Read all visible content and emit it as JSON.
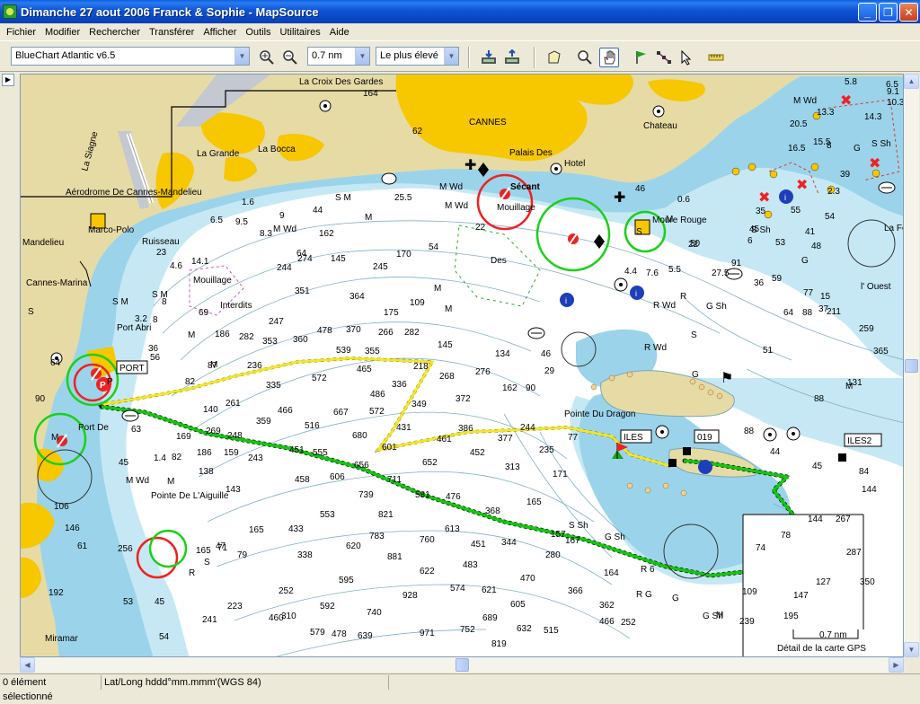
{
  "window": {
    "title": "Dimanche 27 aout 2006 Franck & Sophie - MapSource",
    "minimize": "_",
    "restore": "❐",
    "close": "✕"
  },
  "menu": [
    "Fichier",
    "Modifier",
    "Rechercher",
    "Transférer",
    "Afficher",
    "Outils",
    "Utilitaires",
    "Aide"
  ],
  "toolbar": {
    "map_product": "BlueChart Atlantic v6.5",
    "zoom_scale": "0.7 nm",
    "detail_level": "Le plus élevé"
  },
  "map": {
    "places": {
      "la_croix_des_gardes": "La Croix Des Gardes",
      "cannes": "CANNES",
      "la_bocca": "La Bocca",
      "la_grande": "La Grande",
      "aerodrome": "Aérodrome De Cannes-Mandelieu",
      "la_siagne": "La Siagne",
      "mandelieu": "Mandelieu",
      "marco_polo": "Marco-Polo",
      "ruisseau": "Ruisseau",
      "cannes_marina": "Cannes-Marina",
      "port_abri": "Port Abri",
      "port": "PORT",
      "port_de": "Port De",
      "pointe_aiguille": "Pointe De L'Aiguille",
      "miramar": "Miramar",
      "palais_des": "Palais Des",
      "hotel": "Hotel",
      "secant": "Sécant",
      "mouillage1": "Mouillage",
      "mouillage2": "Mouillage",
      "interdits": "Interdits",
      "des": "Des",
      "chateau": "Chateau",
      "moure_rouge": "Moure Rouge",
      "pointe_du_dragon": "Pointe Du Dragon",
      "iles": "ILES",
      "iles2": "ILES2",
      "wp_019": "019",
      "la_fou": "La Fou",
      "l_ouest": "l' Ouest"
    },
    "scale_label": "0.7 nm",
    "detail_caption": "Détail de la carte GPS",
    "soundings": [
      [
        "164",
        403,
        106
      ],
      [
        "62",
        458,
        148
      ],
      [
        "25.5",
        438,
        222
      ],
      [
        "44",
        347,
        236
      ],
      [
        "M Wd",
        488,
        210
      ],
      [
        "S M",
        372,
        222
      ],
      [
        "M",
        405,
        244
      ],
      [
        "M Wd",
        494,
        231
      ],
      [
        "22",
        528,
        255
      ],
      [
        "9",
        310,
        242
      ],
      [
        "8.3",
        288,
        262
      ],
      [
        "9.5",
        261,
        249
      ],
      [
        "1.6",
        268,
        227
      ],
      [
        "6.5",
        233,
        247
      ],
      [
        "4.6",
        188,
        298
      ],
      [
        "14.1",
        212,
        293
      ],
      [
        "69",
        220,
        350
      ],
      [
        "8",
        179,
        338
      ],
      [
        "M Wd",
        303,
        257
      ],
      [
        "162",
        354,
        262
      ],
      [
        "64",
        329,
        284
      ],
      [
        "274",
        330,
        290
      ],
      [
        "145",
        367,
        290
      ],
      [
        "245",
        414,
        299
      ],
      [
        "170",
        440,
        285
      ],
      [
        "54",
        476,
        277
      ],
      [
        "244",
        307,
        300
      ],
      [
        "351",
        327,
        326
      ],
      [
        "364",
        388,
        332
      ],
      [
        "175",
        426,
        350
      ],
      [
        "109",
        455,
        339
      ],
      [
        "M",
        482,
        323
      ],
      [
        "M",
        494,
        346
      ],
      [
        "247",
        298,
        360
      ],
      [
        "353",
        291,
        382
      ],
      [
        "360",
        325,
        380
      ],
      [
        "478",
        352,
        370
      ],
      [
        "370",
        384,
        369
      ],
      [
        "266",
        420,
        372
      ],
      [
        "282",
        449,
        372
      ],
      [
        "186",
        238,
        374
      ],
      [
        "282",
        265,
        377
      ],
      [
        "236",
        274,
        409
      ],
      [
        "M",
        208,
        375
      ],
      [
        "M",
        233,
        408
      ],
      [
        "82",
        205,
        427
      ],
      [
        "87",
        230,
        409
      ],
      [
        "336",
        435,
        430
      ],
      [
        "486",
        411,
        441
      ],
      [
        "572",
        410,
        460
      ],
      [
        "349",
        457,
        452
      ],
      [
        "372",
        506,
        446
      ],
      [
        "134",
        550,
        396
      ],
      [
        "162",
        558,
        434
      ],
      [
        "90",
        584,
        434
      ],
      [
        "46",
        601,
        396
      ],
      [
        "29",
        605,
        415
      ],
      [
        "335",
        295,
        431
      ],
      [
        "572",
        346,
        423
      ],
      [
        "465",
        396,
        413
      ],
      [
        "355",
        405,
        393
      ],
      [
        "539",
        373,
        392
      ],
      [
        "218",
        459,
        410
      ],
      [
        "268",
        488,
        421
      ],
      [
        "145",
        486,
        386
      ],
      [
        "276",
        528,
        416
      ],
      [
        "261",
        250,
        451
      ],
      [
        "140",
        225,
        458
      ],
      [
        "359",
        284,
        471
      ],
      [
        "466",
        308,
        459
      ],
      [
        "516",
        338,
        476
      ],
      [
        "667",
        370,
        461
      ],
      [
        "680",
        391,
        487
      ],
      [
        "431",
        440,
        478
      ],
      [
        "461",
        485,
        491
      ],
      [
        "386",
        509,
        479
      ],
      [
        "377",
        553,
        490
      ],
      [
        "244",
        578,
        478
      ],
      [
        "77",
        631,
        489
      ],
      [
        "601",
        424,
        500
      ],
      [
        "652",
        469,
        517
      ],
      [
        "452",
        522,
        506
      ],
      [
        "313",
        561,
        522
      ],
      [
        "235",
        599,
        503
      ],
      [
        "171",
        614,
        530
      ],
      [
        "269",
        228,
        482
      ],
      [
        "248",
        252,
        487
      ],
      [
        "169",
        195,
        488
      ],
      [
        "451",
        321,
        503
      ],
      [
        "555",
        347,
        506
      ],
      [
        "656",
        393,
        520
      ],
      [
        "711",
        430,
        536
      ],
      [
        "186",
        218,
        506
      ],
      [
        "138",
        220,
        527
      ],
      [
        "159",
        248,
        506
      ],
      [
        "243",
        275,
        512
      ],
      [
        "458",
        327,
        536
      ],
      [
        "606",
        366,
        533
      ],
      [
        "739",
        398,
        553
      ],
      [
        "821",
        420,
        575
      ],
      [
        "581",
        461,
        553
      ],
      [
        "476",
        495,
        555
      ],
      [
        "368",
        539,
        571
      ],
      [
        "165",
        585,
        561
      ],
      [
        "S Sh",
        632,
        587
      ],
      [
        "157",
        612,
        597
      ],
      [
        "143",
        250,
        547
      ],
      [
        "165",
        276,
        592
      ],
      [
        "553",
        355,
        575
      ],
      [
        "433",
        320,
        591
      ],
      [
        "620",
        384,
        610
      ],
      [
        "783",
        410,
        599
      ],
      [
        "760",
        466,
        603
      ],
      [
        "613",
        494,
        591
      ],
      [
        "451",
        523,
        608
      ],
      [
        "344",
        557,
        606
      ],
      [
        "280",
        606,
        620
      ],
      [
        "167",
        628,
        604
      ],
      [
        "G Sh",
        672,
        600
      ],
      [
        "71",
        241,
        612
      ],
      [
        "47",
        239,
        610
      ],
      [
        "79",
        263,
        620
      ],
      [
        "338",
        330,
        620
      ],
      [
        "881",
        430,
        622
      ],
      [
        "622",
        466,
        638
      ],
      [
        "483",
        514,
        631
      ],
      [
        "470",
        578,
        646
      ],
      [
        "164",
        671,
        640
      ],
      [
        "595",
        376,
        648
      ],
      [
        "928",
        447,
        665
      ],
      [
        "574",
        500,
        657
      ],
      [
        "621",
        535,
        659
      ],
      [
        "366",
        631,
        660
      ],
      [
        "362",
        666,
        676
      ],
      [
        "R 6",
        712,
        636
      ],
      [
        "R G",
        707,
        664
      ],
      [
        "G",
        747,
        668
      ],
      [
        "109",
        825,
        661
      ],
      [
        "M",
        796,
        687
      ],
      [
        "G Sh",
        781,
        688
      ],
      [
        "239",
        822,
        694
      ],
      [
        "147",
        882,
        665
      ],
      [
        "127",
        907,
        650
      ],
      [
        "195",
        871,
        688
      ],
      [
        "350",
        956,
        650
      ],
      [
        "287",
        941,
        617
      ],
      [
        "144",
        958,
        547
      ],
      [
        "267",
        929,
        580
      ],
      [
        "144",
        898,
        580
      ],
      [
        "78",
        868,
        598
      ],
      [
        "74",
        840,
        612
      ],
      [
        "45",
        903,
        521
      ],
      [
        "84",
        955,
        527
      ],
      [
        "88",
        827,
        482
      ],
      [
        "44",
        856,
        505
      ],
      [
        "252",
        690,
        695
      ],
      [
        "466",
        666,
        694
      ],
      [
        "605",
        567,
        675
      ],
      [
        "632",
        574,
        702
      ],
      [
        "515",
        604,
        704
      ],
      [
        "819",
        546,
        719
      ],
      [
        "752",
        511,
        703
      ],
      [
        "689",
        536,
        690
      ],
      [
        "971",
        466,
        707
      ],
      [
        "740",
        407,
        684
      ],
      [
        "592",
        355,
        677
      ],
      [
        "478",
        368,
        708
      ],
      [
        "639",
        397,
        710
      ],
      [
        "579",
        344,
        706
      ],
      [
        "460",
        298,
        690
      ],
      [
        "310",
        312,
        688
      ],
      [
        "252",
        309,
        660
      ],
      [
        "241",
        224,
        692
      ],
      [
        "223",
        252,
        677
      ],
      [
        "192",
        53,
        662
      ],
      [
        "256",
        130,
        613
      ],
      [
        "146",
        71,
        590
      ],
      [
        "106",
        59,
        566
      ],
      [
        "45",
        131,
        517
      ],
      [
        "82",
        190,
        511
      ],
      [
        "63",
        145,
        480
      ],
      [
        "61",
        85,
        610
      ],
      [
        "53",
        136,
        672
      ],
      [
        "45",
        171,
        672
      ],
      [
        "54",
        176,
        711
      ],
      [
        "165",
        217,
        615
      ],
      [
        "R",
        209,
        640
      ],
      [
        "S",
        226,
        628
      ],
      [
        "1.4",
        170,
        512
      ],
      [
        "36",
        164,
        390
      ],
      [
        "56",
        166,
        400
      ],
      [
        "S M",
        168,
        330
      ],
      [
        "M",
        56,
        489
      ],
      [
        "M",
        185,
        538
      ],
      [
        "M Wd",
        139,
        537
      ],
      [
        "90",
        38,
        446
      ],
      [
        "64",
        55,
        406
      ],
      [
        "S",
        30,
        349
      ],
      [
        "S M",
        124,
        338
      ],
      [
        "23",
        173,
        283
      ],
      [
        "3.2",
        149,
        357
      ],
      [
        "P",
        118,
        427
      ],
      [
        "8",
        169,
        358
      ]
    ],
    "soundings_right": [
      [
        "M Wd",
        882,
        114
      ],
      [
        "13.3",
        908,
        127
      ],
      [
        "20.5",
        878,
        140
      ],
      [
        "16.5",
        876,
        167
      ],
      [
        "15.5",
        904,
        160
      ],
      [
        "8",
        919,
        164
      ],
      [
        "39",
        934,
        196
      ],
      [
        "2.3",
        920,
        215
      ],
      [
        "55",
        879,
        236
      ],
      [
        "35",
        840,
        237
      ],
      [
        "54",
        917,
        243
      ],
      [
        "45",
        833,
        257
      ],
      [
        "6",
        831,
        270
      ],
      [
        "S Sh",
        835,
        258
      ],
      [
        "53",
        862,
        272
      ],
      [
        "41",
        895,
        260
      ],
      [
        "48",
        902,
        276
      ],
      [
        "G",
        891,
        292
      ],
      [
        "91",
        813,
        295
      ],
      [
        "36",
        838,
        317
      ],
      [
        "59",
        858,
        312
      ],
      [
        "77",
        893,
        328
      ],
      [
        "15",
        912,
        332
      ],
      [
        "37",
        910,
        346
      ],
      [
        "64",
        871,
        350
      ],
      [
        "88",
        892,
        350
      ],
      [
        "211",
        919,
        349
      ],
      [
        "259",
        955,
        368
      ],
      [
        "131",
        942,
        428
      ],
      [
        "88",
        905,
        446
      ],
      [
        "365",
        971,
        393
      ],
      [
        "6.5",
        985,
        96
      ],
      [
        "9.1",
        986,
        104
      ],
      [
        "10.3",
        986,
        116
      ],
      [
        "5.8",
        939,
        93
      ],
      [
        "14.3",
        961,
        132
      ],
      [
        "S Sh",
        969,
        162
      ],
      [
        "G",
        949,
        167
      ],
      [
        "M",
        940,
        432
      ],
      [
        "G Sh",
        785,
        343
      ],
      [
        "R",
        756,
        332
      ],
      [
        "R Wd",
        716,
        389
      ],
      [
        "R Wd",
        726,
        342
      ],
      [
        "51",
        848,
        392
      ],
      [
        "G",
        769,
        419
      ],
      [
        "S",
        768,
        375
      ],
      [
        "27.5",
        791,
        306
      ],
      [
        "50",
        767,
        273
      ],
      [
        "22",
        765,
        274
      ],
      [
        "5.5",
        743,
        302
      ],
      [
        "7.6",
        718,
        306
      ],
      [
        "4.4",
        694,
        304
      ],
      [
        "46",
        706,
        212
      ],
      [
        "0.6",
        753,
        224
      ],
      [
        "M",
        740,
        246
      ],
      [
        "S",
        707,
        260
      ]
    ],
    "route_labels": [
      [
        "PORT",
        131,
        412
      ],
      [
        "ILES",
        692,
        489
      ],
      [
        "019",
        774,
        489
      ],
      [
        "ILES2",
        941,
        493
      ]
    ]
  },
  "status": {
    "selection": "0 élément sélectionné",
    "coordinate_format": "Lat/Long hddd°mm.mmm'(WGS 84)"
  },
  "colors": {
    "land": "#E6DBA5",
    "town": "#F7C700",
    "shallow": "#9BD4EA",
    "mid_water": "#C6E8F5",
    "deep": "#FFFFFF",
    "route": "#12C70E",
    "track": "#F4E71F",
    "xp_blue": "#0A3FB0"
  }
}
